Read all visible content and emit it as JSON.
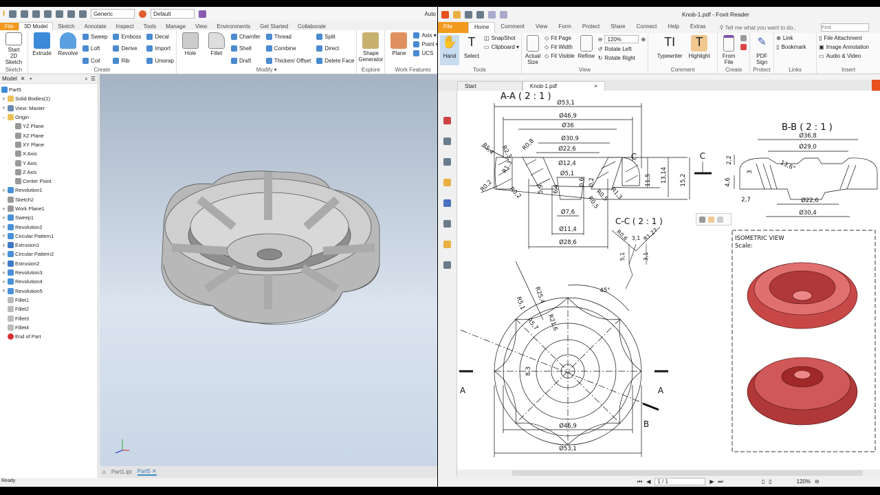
{
  "inventor": {
    "qat": {
      "appearance": "Generic",
      "style": "Default",
      "title_fragment": "Auto"
    },
    "tabs": [
      "File",
      "3D Model",
      "Sketch",
      "Annotate",
      "Inspect",
      "Tools",
      "Manage",
      "View",
      "Environments",
      "Get Started",
      "Collaborate"
    ],
    "ribbon": {
      "sketch": {
        "start": "Start",
        "start2": "2D Sketch",
        "label": "Sketch"
      },
      "create": {
        "extrude": "Extrude",
        "revolve": "Revolve",
        "small": [
          "Sweep",
          "Loft",
          "Coil",
          "Emboss",
          "Derive",
          "Rib",
          "Decal",
          "Import",
          "Unwrap"
        ],
        "label": "Create"
      },
      "modify": {
        "hole": "Hole",
        "fillet": "Fillet",
        "small": [
          "Chamfer",
          "Shell",
          "Draft",
          "Thread",
          "Combine",
          "Thicken/ Offset",
          "Split",
          "Direct",
          "Delete Face"
        ],
        "label": "Modify ▾"
      },
      "explore": {
        "shape": "Shape",
        "gen": "Generator",
        "label": "Explore"
      },
      "work": {
        "plane": "Plane",
        "small": [
          "Axis ▾",
          "Point ▾",
          "UCS"
        ],
        "label": "Work Features"
      }
    },
    "browser": {
      "tab": "Model",
      "items": [
        {
          "label": "Part5",
          "lvl": 0,
          "pm": "",
          "c": "#3c8ad8"
        },
        {
          "label": "Solid Bodies(1)",
          "lvl": 1,
          "pm": "+",
          "c": "#e8c25a"
        },
        {
          "label": "View: Master",
          "lvl": 1,
          "pm": "+",
          "c": "#6a8ab0"
        },
        {
          "label": "Origin",
          "lvl": 1,
          "pm": "−",
          "c": "#e8c25a"
        },
        {
          "label": "YZ Plane",
          "lvl": 2,
          "pm": "",
          "c": "#999"
        },
        {
          "label": "XZ Plane",
          "lvl": 2,
          "pm": "",
          "c": "#999"
        },
        {
          "label": "XY Plane",
          "lvl": 2,
          "pm": "",
          "c": "#999"
        },
        {
          "label": "X Axis",
          "lvl": 2,
          "pm": "",
          "c": "#999"
        },
        {
          "label": "Y Axis",
          "lvl": 2,
          "pm": "",
          "c": "#999"
        },
        {
          "label": "Z Axis",
          "lvl": 2,
          "pm": "",
          "c": "#999"
        },
        {
          "label": "Center Point",
          "lvl": 2,
          "pm": "",
          "c": "#999"
        },
        {
          "label": "Revolution1",
          "lvl": 1,
          "pm": "+",
          "c": "#4a90d8"
        },
        {
          "label": "Sketch2",
          "lvl": 1,
          "pm": "",
          "c": "#999"
        },
        {
          "label": "Work Plane1",
          "lvl": 1,
          "pm": "+",
          "c": "#999"
        },
        {
          "label": "Sweep1",
          "lvl": 1,
          "pm": "+",
          "c": "#4a90d8"
        },
        {
          "label": "Revolution2",
          "lvl": 1,
          "pm": "+",
          "c": "#4a90d8"
        },
        {
          "label": "Circular Pattern1",
          "lvl": 1,
          "pm": "+",
          "c": "#4a90d8"
        },
        {
          "label": "Extrusion1",
          "lvl": 1,
          "pm": "+",
          "c": "#3c7ac8"
        },
        {
          "label": "Circular Pattern2",
          "lvl": 1,
          "pm": "+",
          "c": "#4a90d8"
        },
        {
          "label": "Extrusion2",
          "lvl": 1,
          "pm": "+",
          "c": "#3c7ac8"
        },
        {
          "label": "Revolution3",
          "lvl": 1,
          "pm": "+",
          "c": "#4a90d8"
        },
        {
          "label": "Revolution4",
          "lvl": 1,
          "pm": "+",
          "c": "#4a90d8"
        },
        {
          "label": "Revolution5",
          "lvl": 1,
          "pm": "+",
          "c": "#4a90d8"
        },
        {
          "label": "Fillet1",
          "lvl": 1,
          "pm": "",
          "c": "#bbb"
        },
        {
          "label": "Fillet2",
          "lvl": 1,
          "pm": "",
          "c": "#bbb"
        },
        {
          "label": "Fillet3",
          "lvl": 1,
          "pm": "",
          "c": "#bbb"
        },
        {
          "label": "Fillet4",
          "lvl": 1,
          "pm": "",
          "c": "#bbb"
        },
        {
          "label": "End of Part",
          "lvl": 1,
          "pm": "",
          "c": "#d63030"
        }
      ]
    },
    "doc_tabs": [
      "Part1.ipt",
      "Part5"
    ],
    "status": "Ready"
  },
  "foxit": {
    "title": "Knob-1.pdf - Foxit Reader",
    "tabs": [
      "File",
      "Home",
      "Comment",
      "View",
      "Form",
      "Protect",
      "Share",
      "Connect",
      "Help",
      "Extras"
    ],
    "tell_me": "Tell me what you want to do..",
    "find_placeholder": "Find",
    "ribbon": {
      "tools": {
        "hand": "Hand",
        "select": "Select",
        "snapshot": "SnapShot",
        "clipboard": "Clipboard ▾",
        "label": "Tools"
      },
      "view": {
        "actual": "Actual",
        "size": "Size",
        "fitpage": "Fit Page",
        "fitwidth": "Fit Width",
        "fitvisible": "Fit Visible",
        "reflow": "Reflow",
        "zoom": "120%",
        "rotl": "Rotate Left",
        "rotr": "Rotate Right",
        "label": "View"
      },
      "comment": {
        "typewriter": "Typewriter",
        "highlight": "Highlight",
        "label": "Comment"
      },
      "create": {
        "from": "From",
        "file": "File",
        "label": "Create"
      },
      "protect": {
        "pdf": "PDF",
        "sign": "Sign",
        "label": "Protect"
      },
      "links": {
        "link": "Link",
        "bookmark": "Bookmark",
        "label": "Links"
      },
      "insert": {
        "attach": "File Attachment",
        "image": "Image Annotation",
        "audio": "Audio & Video",
        "label": "Insert"
      }
    },
    "doc_tabs": [
      "Start",
      "Knob-1.pdf"
    ],
    "page": "1 / 1",
    "zoom": "120%"
  },
  "drawing": {
    "aa": {
      "title": "A-A ( 2 : 1 )",
      "d": [
        "Ø53,1",
        "Ø46,9",
        "Ø36",
        "Ø30,9",
        "Ø22,6",
        "Ø12,4",
        "Ø5,1",
        "Ø7,6",
        "Ø11,4",
        "Ø28,6"
      ],
      "r": [
        "R5,4",
        "R2,3",
        "R0,8",
        "R1,3",
        "R0,2",
        "R0,2",
        "R0,5",
        "R0,5",
        "R1,3"
      ],
      "v": [
        "11,5",
        "13,14",
        "15,2",
        "5,9",
        "6,4",
        "0,6",
        "0,2"
      ],
      "c": "C"
    },
    "bb": {
      "title": "B-B ( 2 : 1 )",
      "d": [
        "Ø36,8",
        "Ø29,0",
        "Ø22,6",
        "Ø30,4"
      ],
      "v": [
        "2,2",
        "4,6",
        "3",
        "2,7"
      ],
      "angle": "13,6°"
    },
    "cc": {
      "title": "C-C ( 2 : 1 )",
      "d": [
        "R0,6",
        "3,1",
        "R1,27",
        "5,1",
        "3,1"
      ]
    },
    "plan": {
      "d": [
        "R25,4",
        "R5,1",
        "R5,7",
        "R21,6",
        "45°",
        "Ø46,9",
        "Ø53,1",
        "8,3"
      ],
      "a": "A",
      "b": "B"
    },
    "iso": {
      "title": "ISOMETRIC VIEW",
      "scale": "Scale:"
    }
  }
}
